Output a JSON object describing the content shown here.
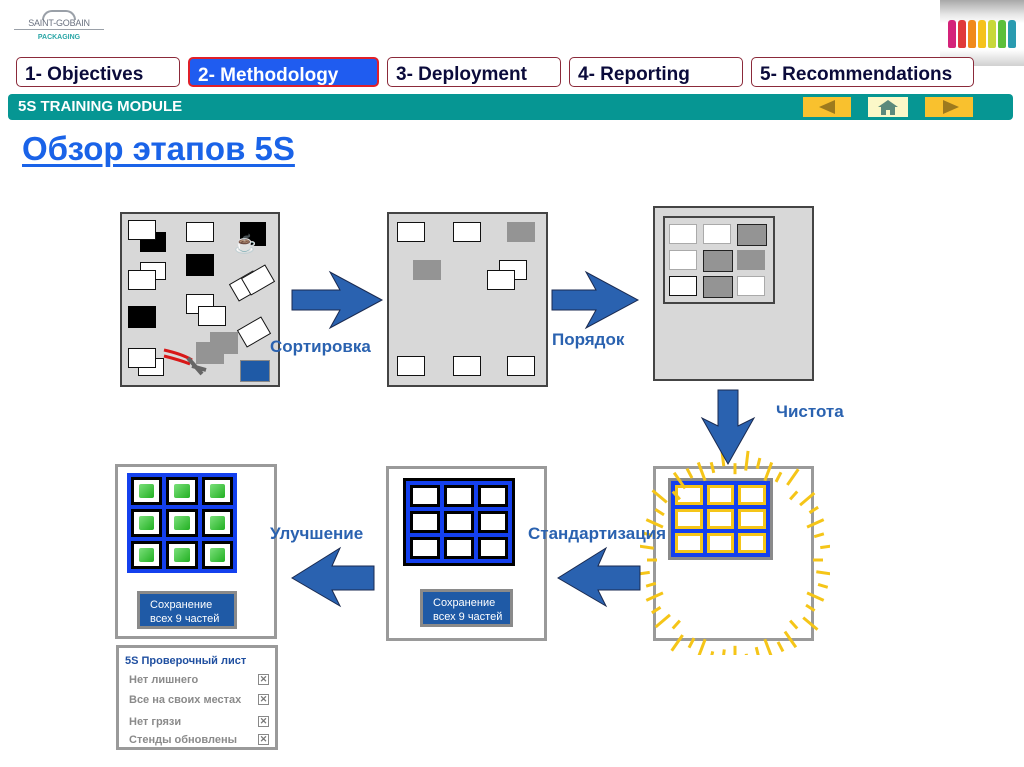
{
  "logo": {
    "brand": "SAINT-GOBAIN",
    "sub": "PACKAGING"
  },
  "thumbnail": {
    "icon": "bottles-image",
    "bottle_colors": [
      "#d4237a",
      "#e03a3a",
      "#f08a1c",
      "#f5c21c",
      "#c8d83a",
      "#5cbf3a",
      "#2a9bb0"
    ]
  },
  "tabs": [
    {
      "label": "1- Objectives",
      "active": false
    },
    {
      "label": "2- Methodology",
      "active": true
    },
    {
      "label": "3- Deployment",
      "active": false
    },
    {
      "label": "4- Reporting",
      "active": false
    },
    {
      "label": "5- Recommendations",
      "active": false
    }
  ],
  "module_bar": {
    "title": "5S TRAINING MODULE",
    "buttons": {
      "prev": "prev-icon",
      "home": "home-icon",
      "next": "next-icon"
    }
  },
  "page_title": "Обзор этапов 5S",
  "steps": {
    "sort": "Сортировка",
    "order": "Порядок",
    "clean": "Чистота",
    "standardize": "Стандартизация",
    "improve": "Улучшение"
  },
  "save_box": {
    "line1": "Сохранение",
    "line2": "всех 9 частей"
  },
  "checklist": {
    "title": "5S Проверочный лист",
    "items": [
      {
        "label": "Нет лишнего",
        "checked": true
      },
      {
        "label": "Все на своих местах",
        "checked": true
      },
      {
        "label": "Нет грязи",
        "checked": true
      },
      {
        "label": "Стенды обновлены",
        "checked": true
      }
    ]
  },
  "colors": {
    "accent_blue": "#1f5cf0",
    "teal": "#069693",
    "arrow_blue": "#2a62b0",
    "nav_yellow": "#f9c12e",
    "sparkle_yellow": "#f5c518"
  }
}
